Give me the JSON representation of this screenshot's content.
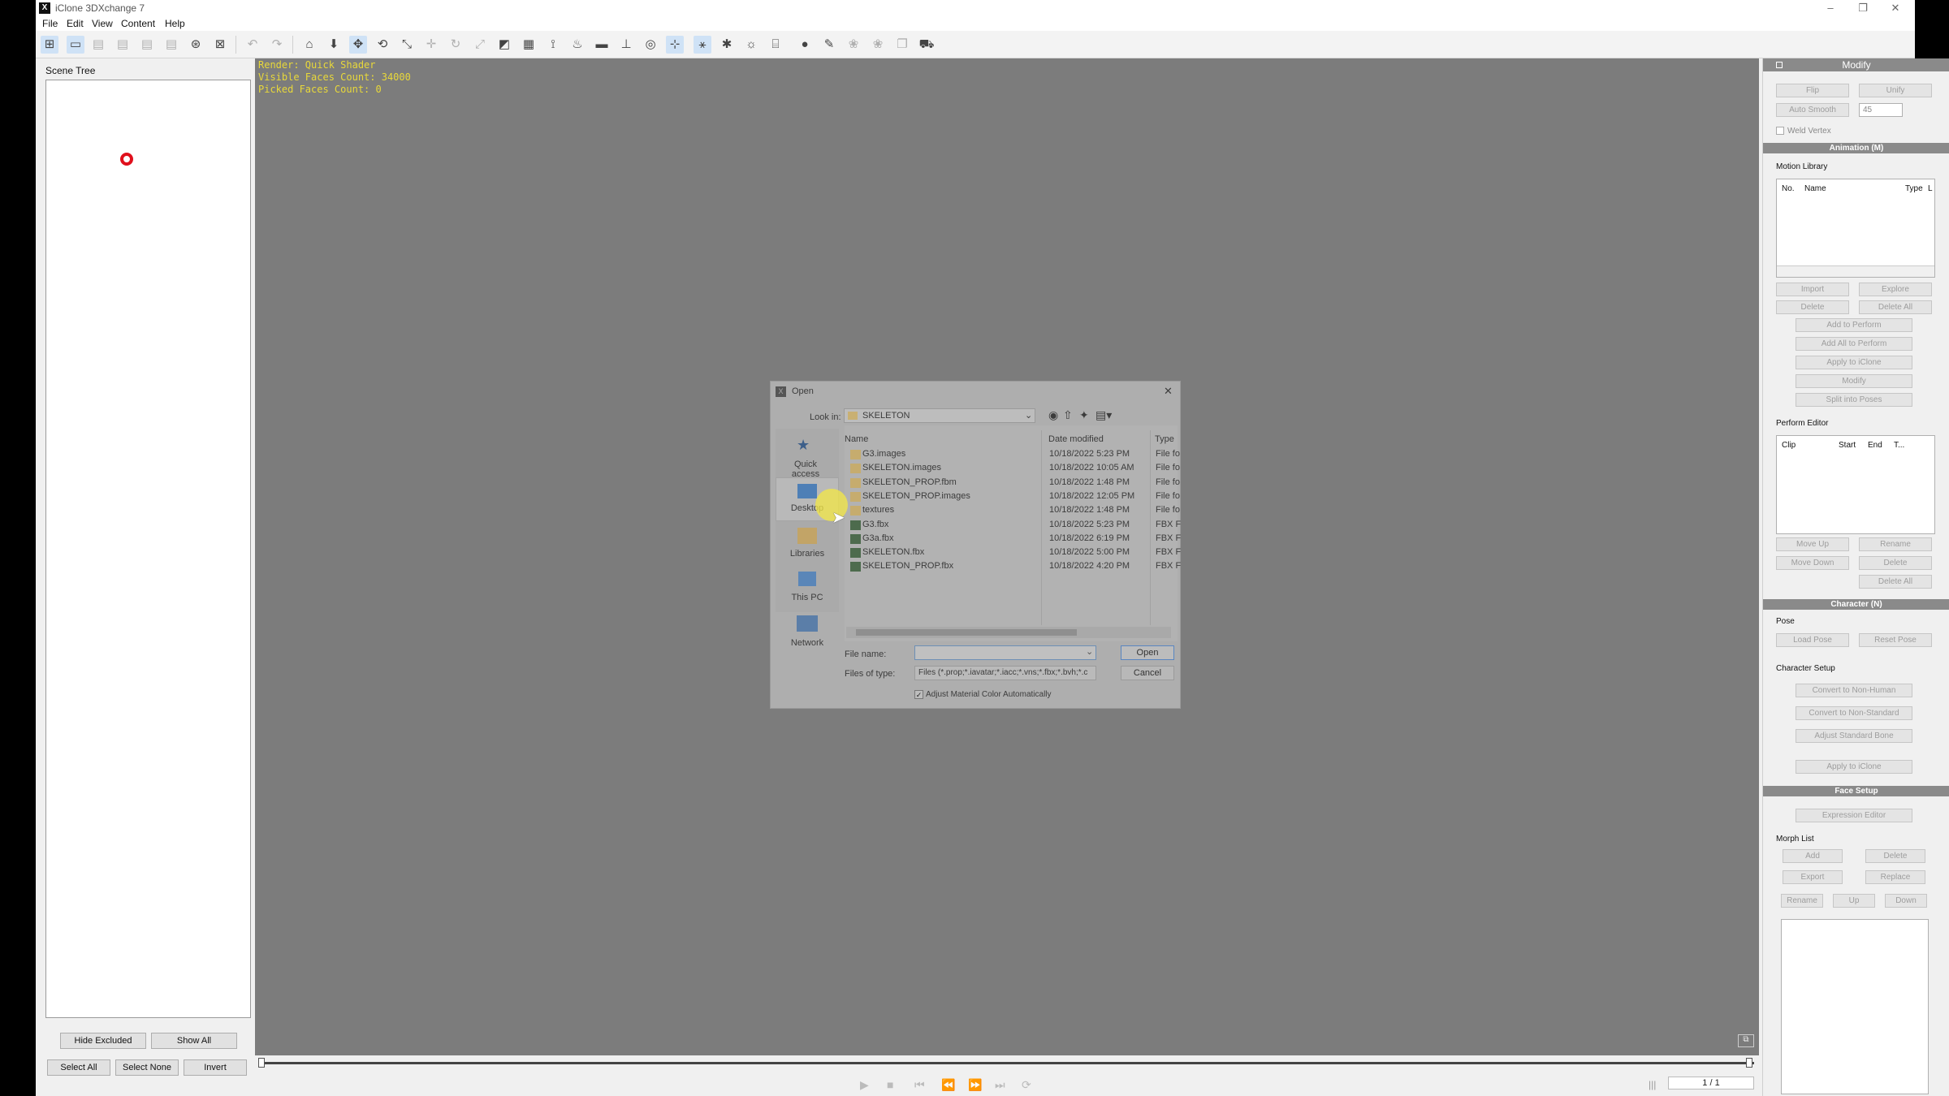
{
  "app": {
    "title": "iClone 3DXchange 7"
  },
  "menu": [
    "File",
    "Edit",
    "View",
    "Content",
    "Help"
  ],
  "scene_tree": {
    "title": "Scene Tree",
    "buttons": {
      "hide_excluded": "Hide Excluded",
      "show_all": "Show All",
      "select_all": "Select All",
      "select_none": "Select None",
      "invert": "Invert"
    }
  },
  "viewport": {
    "render": "Render: Quick Shader",
    "visible_faces": "Visible Faces Count: 34000",
    "picked_faces": "Picked Faces Count: 0"
  },
  "timeline": {
    "frame": "1 / 1",
    "start": "0"
  },
  "panel": {
    "title": "Modify",
    "flip": "Flip",
    "unify": "Unify",
    "auto_smooth": "Auto Smooth",
    "smooth_angle": "45",
    "weld_vertex": "Weld Vertex",
    "animation": {
      "header": "Animation (M)",
      "motion_library": "Motion Library",
      "columns": [
        "No.",
        "Name",
        "Type",
        "L"
      ],
      "import": "Import",
      "explore": "Explore",
      "delete": "Delete",
      "delete_all": "Delete All",
      "add_to_perform": "Add to Perform",
      "add_all_to_perform": "Add All to Perform",
      "apply_to_iclone": "Apply to iClone",
      "modify": "Modify",
      "split_into_poses": "Split into Poses",
      "perform_editor": "Perform Editor",
      "perform_columns": [
        "Clip",
        "Start",
        "End",
        "T..."
      ],
      "move_up": "Move Up",
      "rename": "Rename",
      "move_down": "Move Down",
      "delete2": "Delete",
      "delete_all2": "Delete All"
    },
    "character": {
      "header": "Character (N)",
      "pose": "Pose",
      "load_pose": "Load Pose",
      "reset_pose": "Reset Pose",
      "setup": "Character Setup",
      "to_non_human": "Convert to Non-Human",
      "to_non_standard": "Convert to Non-Standard",
      "adjust_bone": "Adjust Standard Bone",
      "apply": "Apply to iClone"
    },
    "face": {
      "header": "Face Setup",
      "expression_editor": "Expression Editor",
      "morph_list": "Morph List",
      "add": "Add",
      "delete": "Delete",
      "export": "Export",
      "replace": "Replace",
      "rename": "Rename",
      "up": "Up",
      "down": "Down"
    }
  },
  "dialog": {
    "title": "Open",
    "look_in_label": "Look in:",
    "look_in": "SKELETON",
    "sidebar": [
      "Quick access",
      "Desktop",
      "Libraries",
      "This PC",
      "Network"
    ],
    "columns": {
      "name": "Name",
      "date": "Date modified",
      "type": "Type"
    },
    "files": [
      {
        "name": "G3.images",
        "date": "10/18/2022 5:23 PM",
        "type": "File fo",
        "kind": "folder"
      },
      {
        "name": "SKELETON.images",
        "date": "10/18/2022 10:05 AM",
        "type": "File fo",
        "kind": "folder"
      },
      {
        "name": "SKELETON_PROP.fbm",
        "date": "10/18/2022 1:48 PM",
        "type": "File fo",
        "kind": "folder"
      },
      {
        "name": "SKELETON_PROP.images",
        "date": "10/18/2022 12:05 PM",
        "type": "File fo",
        "kind": "folder"
      },
      {
        "name": "textures",
        "date": "10/18/2022 1:48 PM",
        "type": "File fo",
        "kind": "folder"
      },
      {
        "name": "G3.fbx",
        "date": "10/18/2022 5:23 PM",
        "type": "FBX F",
        "kind": "fbx"
      },
      {
        "name": "G3a.fbx",
        "date": "10/18/2022 6:19 PM",
        "type": "FBX F",
        "kind": "fbx"
      },
      {
        "name": "SKELETON.fbx",
        "date": "10/18/2022 5:00 PM",
        "type": "FBX F",
        "kind": "fbx"
      },
      {
        "name": "SKELETON_PROP.fbx",
        "date": "10/18/2022 4:20 PM",
        "type": "FBX F",
        "kind": "fbx"
      }
    ],
    "file_name_label": "File name:",
    "file_name_value": "",
    "files_of_type_label": "Files of type:",
    "files_of_type": "Files (*.prop;*.iavatar;*.iacc;*.vns;*.fbx;*.bvh;*.c",
    "adjust_material": "Adjust Material Color Automatically",
    "open": "Open",
    "cancel": "Cancel"
  },
  "colors": {
    "viewport_bg": "#7c7c7c",
    "overlay_text": "#e8d83a",
    "section_header": "#8a8a8a",
    "dialog_bg": "#aeaeae"
  }
}
